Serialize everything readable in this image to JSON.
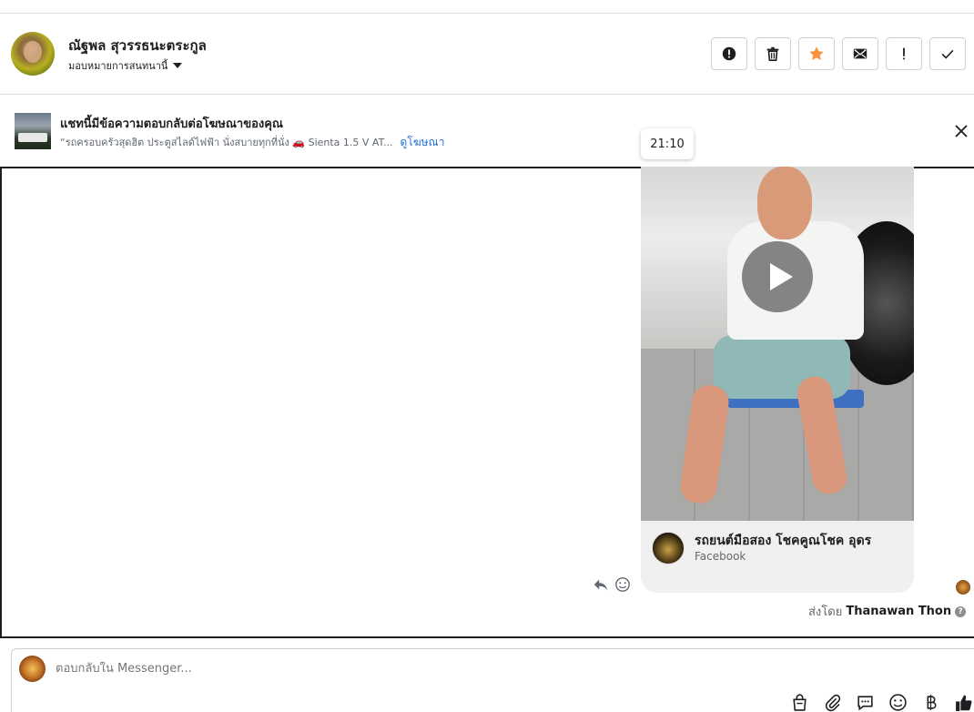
{
  "header": {
    "contact_name": "ณัฐพล สุวรรธนะตระกูล",
    "assign_label": "มอบหมายการสนทนานี้",
    "actions": [
      {
        "name": "report-spam-icon",
        "tooltip": "!"
      },
      {
        "name": "trash-icon"
      },
      {
        "name": "star-icon"
      },
      {
        "name": "mark-unread-icon"
      },
      {
        "name": "follow-up-icon",
        "label": "!"
      },
      {
        "name": "done-check-icon"
      }
    ],
    "star_color": "#f7923a"
  },
  "ad_banner": {
    "title": "แชทนี้มีข้อความตอบกลับต่อโฆษณาของคุณ",
    "subtitle": "“รถครอบครัวสุดฮิต ประตูสไลด์ไฟฟ้า นั่งสบายทุกที่นั่ง 🚗 Sienta 1.5 V AT...",
    "link": "ดูโฆษณา"
  },
  "message": {
    "time_tooltip": "21:10",
    "page_name": "รถยนต์มือสอง โชคคูณโชค อุดร",
    "page_source": "Facebook"
  },
  "sent_by": {
    "prefix": "ส่งโดย",
    "name": "Thanawan Thon",
    "help": "?"
  },
  "composer": {
    "placeholder": "ตอบกลับใน Messenger..."
  },
  "colors": {
    "link": "#216fdb",
    "border": "#ccd0d5",
    "like": "#1c1e21"
  }
}
